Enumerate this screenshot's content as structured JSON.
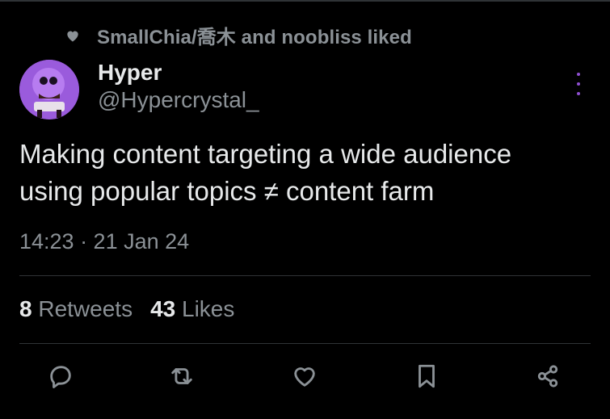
{
  "social_context": {
    "text": "SmallChia/喬木 and noobliss liked",
    "icon": "heart-icon"
  },
  "author": {
    "name": "Hyper",
    "handle": "@Hypercrystal_",
    "avatar_color": "#8e4fd0"
  },
  "tweet": {
    "text_line1": "Making content targeting a wide audience",
    "text_line2": "using popular topics ≠ content farm",
    "timestamp": "14:23 · 21 Jan 24"
  },
  "stats": {
    "retweets_count": "8",
    "retweets_label": "Retweets",
    "likes_count": "43",
    "likes_label": "Likes"
  },
  "actions": [
    "reply-icon",
    "retweet-icon",
    "like-icon",
    "bookmark-icon",
    "share-icon"
  ],
  "colors": {
    "background": "#000000",
    "text": "#e7e9ea",
    "muted": "#8b9196",
    "accent": "#8e4fd0",
    "divider": "#2f3336"
  }
}
